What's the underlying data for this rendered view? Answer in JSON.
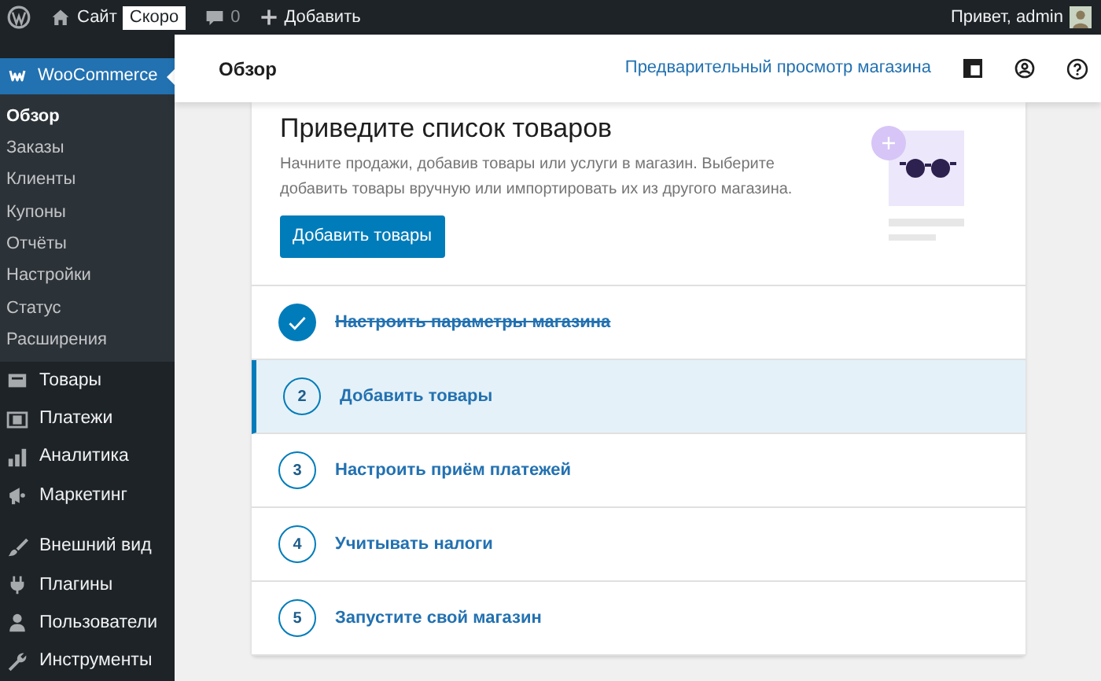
{
  "admin_bar": {
    "site": "Сайт",
    "badge": "Скоро",
    "comments": "0",
    "add": "Добавить",
    "greeting": "Привет, admin"
  },
  "sidebar": {
    "plugin": "WooCommerce",
    "submenu": [
      {
        "label": "Обзор",
        "selected": true
      },
      {
        "label": "Заказы",
        "selected": false
      },
      {
        "label": "Клиенты",
        "selected": false
      },
      {
        "label": "Купоны",
        "selected": false
      },
      {
        "label": "Отчёты",
        "selected": false
      },
      {
        "label": "Настройки",
        "selected": false
      },
      {
        "label": "Статус",
        "selected": false
      },
      {
        "label": "Расширения",
        "selected": false
      }
    ],
    "menu": [
      {
        "label": "Товары"
      },
      {
        "label": "Платежи"
      },
      {
        "label": "Аналитика"
      },
      {
        "label": "Маркетинг"
      },
      {
        "label": "Внешний вид"
      },
      {
        "label": "Плагины"
      },
      {
        "label": "Пользователи"
      },
      {
        "label": "Инструменты"
      }
    ]
  },
  "header": {
    "title": "Обзор",
    "preview_link": "Предварительный просмотр магазина"
  },
  "card": {
    "title": "Приведите список товаров",
    "description": "Начните продажи, добавив товары или услуги в магазин. Выберите добавить товары вручную или импортировать их из другого магазина.",
    "button": "Добавить товары"
  },
  "tasks": [
    {
      "label": "Настроить параметры магазина",
      "completed": true,
      "selected": false
    },
    {
      "number": "2",
      "label": "Добавить товары",
      "completed": false,
      "selected": true
    },
    {
      "number": "3",
      "label": "Настроить приём платежей",
      "completed": false,
      "selected": false
    },
    {
      "number": "4",
      "label": "Учитывать налоги",
      "completed": false,
      "selected": false
    },
    {
      "number": "5",
      "label": "Запустите свой магазин",
      "completed": false,
      "selected": false
    }
  ]
}
